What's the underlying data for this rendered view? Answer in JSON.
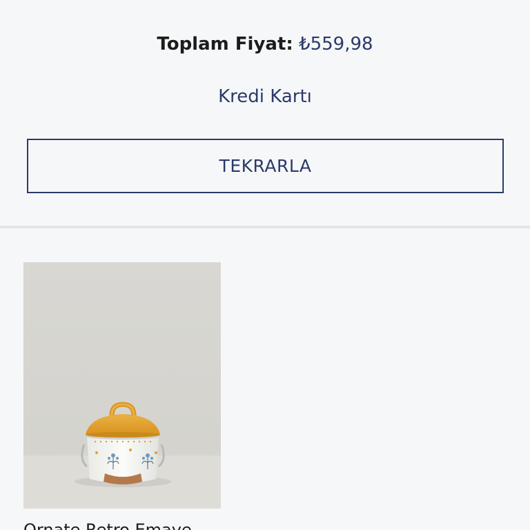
{
  "order": {
    "total_label": "Toplam Fiyat:",
    "total_value": "₺559,98",
    "payment_method": "Kredi Kartı",
    "repeat_button_label": "TEKRARLA"
  },
  "product": {
    "name": "Ornate Retro Emaye"
  },
  "colors": {
    "accent": "#2b3a67",
    "background": "#f6f7f9",
    "divider": "#e3e4e6",
    "pot_lid": "#e0a026"
  }
}
